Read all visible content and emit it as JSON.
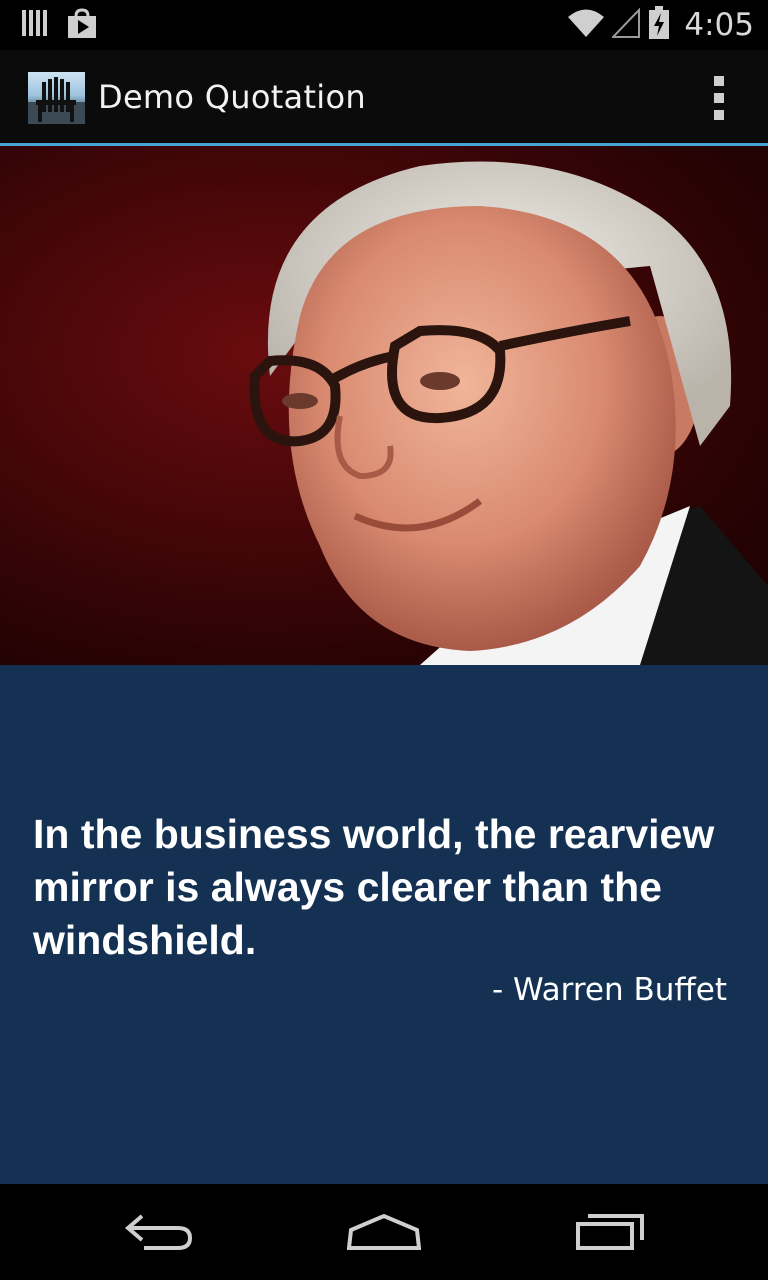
{
  "status_bar": {
    "time": "4:05",
    "icons": [
      "barcode-icon",
      "play-store-icon",
      "wifi-icon",
      "signal-icon",
      "battery-icon"
    ]
  },
  "action_bar": {
    "title": "Demo Quotation",
    "app_icon": "adirondack-chair-icon",
    "menu_icon": "overflow-menu-icon"
  },
  "quote": {
    "text": "In the business world, the rearview mirror is always clearer than the windshield.",
    "author": "- Warren Buffet"
  },
  "navigation": {
    "buttons": [
      "back-icon",
      "home-icon",
      "recent-apps-icon"
    ]
  },
  "colors": {
    "accent_divider": "#4aa3d6",
    "quote_background": "#143153",
    "photo_background": "#4a0709"
  }
}
